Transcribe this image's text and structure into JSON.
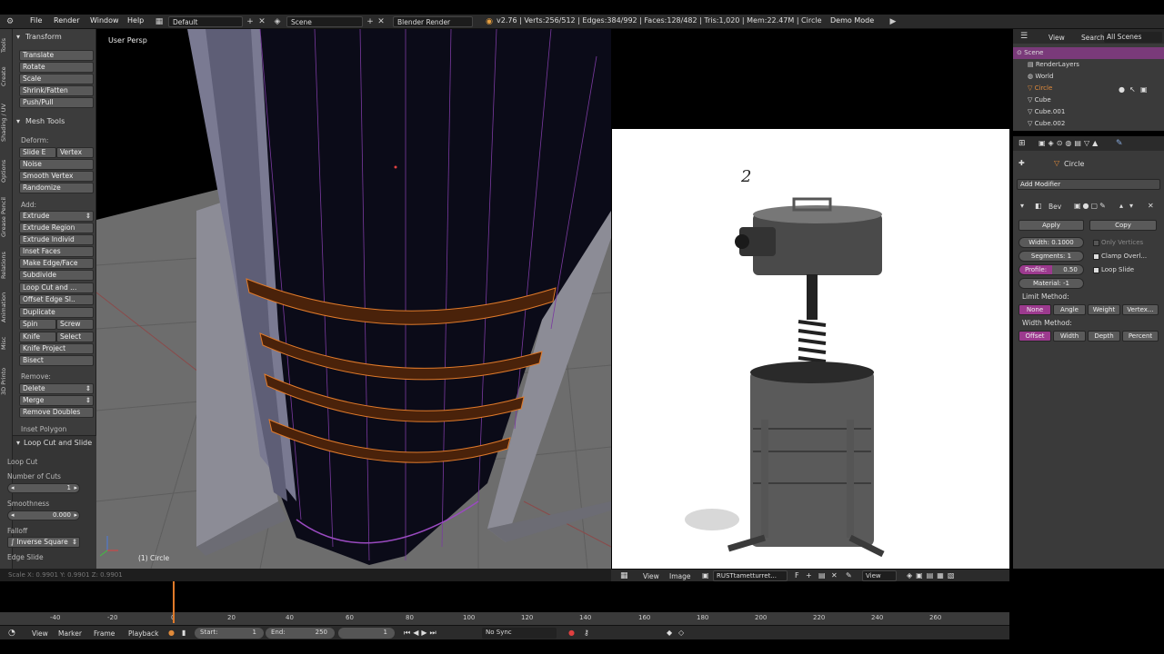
{
  "topbar": {
    "menus": [
      "File",
      "Render",
      "Window",
      "Help"
    ],
    "layout": "Default",
    "scene": "Scene",
    "engine": "Blender Render",
    "stats": "v2.76 | Verts:256/512 | Edges:384/992 | Faces:128/482 | Tris:1,020 | Mem:22.47M | Circle",
    "demo_mode": "Demo Mode"
  },
  "tool_tabs": [
    "Tools",
    "Create",
    "Shading / UV",
    "Options",
    "Grease Pencil",
    "Relations",
    "Animation",
    "Misc",
    "3D Printo"
  ],
  "tools": {
    "transform_title": "Transform",
    "transform": [
      "Translate",
      "Rotate",
      "Scale",
      "Shrink/Fatten",
      "Push/Pull"
    ],
    "mesh_title": "Mesh Tools",
    "deform_label": "Deform:",
    "slide_edge": "Slide E",
    "vertex": "Vertex",
    "deform": [
      "Noise",
      "Smooth Vertex",
      "Randomize"
    ],
    "add_label": "Add:",
    "extrude": "Extrude",
    "add": [
      "Extrude Region",
      "Extrude Individ",
      "Inset Faces",
      "Make Edge/Face",
      "Subdivide",
      "Loop Cut and ...",
      "Offset Edge Sl..",
      "Duplicate"
    ],
    "spin": "Spin",
    "screw": "Screw",
    "knife": "Knife",
    "select": "Select",
    "knife_project": "Knife Project",
    "bisect": "Bisect",
    "remove_label": "Remove:",
    "delete": "Delete",
    "merge": "Merge",
    "remove_doubles": "Remove Doubles",
    "inset_polygon": "Inset Polygon",
    "op_title": "Loop Cut and Slide",
    "loop_cut": "Loop Cut",
    "number_of_cuts_label": "Number of Cuts",
    "number_of_cuts": "1",
    "smoothness_label": "Smoothness",
    "smoothness": "0.000",
    "falloff_label": "Falloff",
    "falloff": "Inverse Square",
    "edge_slide": "Edge Slide"
  },
  "viewport": {
    "label": "User Persp",
    "object_label": "(1) Circle",
    "status": "Scale X: 0.9901  Y: 0.9901  Z: 0.9901"
  },
  "image_editor": {
    "annotation": "2",
    "header": [
      "View",
      "Image"
    ],
    "image_name": "RUSTtametturret...",
    "view": "View"
  },
  "outliner": {
    "menus": [
      "View",
      "Search",
      "All Scenes"
    ],
    "rows": [
      {
        "name": "Scene",
        "selected": true
      },
      {
        "name": "RenderLayers"
      },
      {
        "name": "World"
      },
      {
        "name": "Circle",
        "orange": true
      },
      {
        "name": "Cube"
      },
      {
        "name": "Cube.001"
      },
      {
        "name": "Cube.002"
      }
    ]
  },
  "properties": {
    "object": "Circle",
    "add_modifier": "Add Modifier",
    "modifier_name": "Bev",
    "apply": "Apply",
    "copy": "Copy",
    "width_field": "Width: 0.1000",
    "segments_field": "Segments: 1",
    "profile_label": "Profile:",
    "profile_value": "0.50",
    "material_field": "Material: -1",
    "only_vertices": "Only Vertices",
    "clamp_overlap": "Clamp Overl...",
    "loop_slide": "Loop Slide",
    "limit_method_label": "Limit Method:",
    "limit_methods": [
      "None",
      "Angle",
      "Weight",
      "Vertex..."
    ],
    "width_method_label": "Width Method:",
    "width_methods": [
      "Offset",
      "Width",
      "Depth",
      "Percent"
    ]
  },
  "timeline": {
    "ticks": [
      "-40",
      "-20",
      "0",
      "20",
      "40",
      "60",
      "80",
      "100",
      "120",
      "140",
      "160",
      "180",
      "200",
      "220",
      "240",
      "260"
    ],
    "current_frame_value": 0,
    "menus": [
      "View",
      "Marker",
      "Frame",
      "Playback"
    ],
    "start": "Start:",
    "start_value": "1",
    "end": "End:",
    "end_value": "250",
    "frame_value": "1",
    "sync": "No Sync"
  },
  "colors": {
    "accent": "#9c3a8e",
    "selection_orange": "#e07a2a",
    "panel_bg": "#3c3c3c"
  }
}
